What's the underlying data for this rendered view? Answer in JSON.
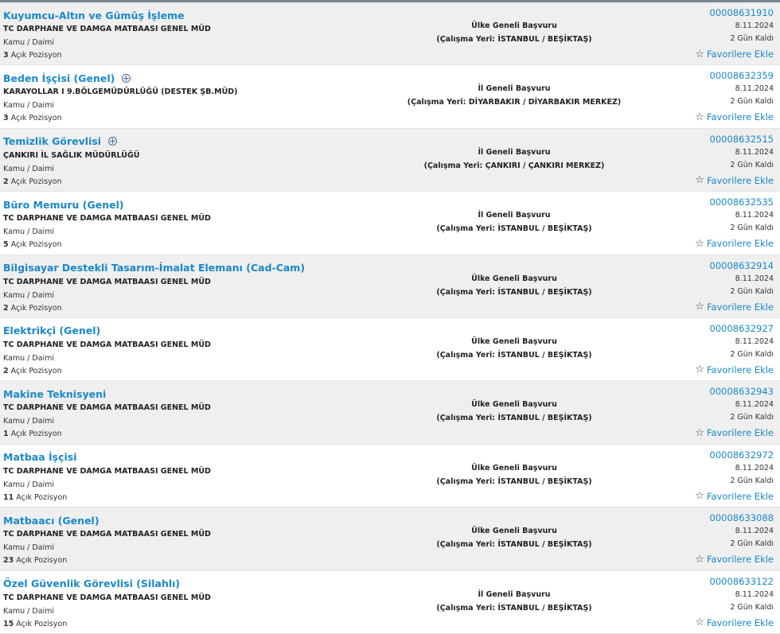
{
  "jobs": [
    {
      "title": "Kuyumcu-Altın ve Gümüş İşleme",
      "disabled": false,
      "org": "TC DARPHANE VE DAMGA MATBAASI GENEL MÜD",
      "type": "Kamu / Daimi",
      "positions_count": "3",
      "positions_label": "Açık Pozisyon",
      "scope": "Ülke Geneli Başvuru",
      "location": "(Çalışma Yeri: İSTANBUL / BEŞİKTAŞ)",
      "job_no": "00008631910",
      "date": "8.11.2024",
      "days_left": "2 Gün Kaldı",
      "fav_label": "Favorilere Ekle"
    },
    {
      "title": "Beden İşçisi (Genel)",
      "disabled": true,
      "org": "KARAYOLLAR I 9.BÖLGEMÜDÜRLÜĞÜ (DESTEK ŞB.MÜD)",
      "type": "Kamu / Daimi",
      "positions_count": "3",
      "positions_label": "Açık Pozisyon",
      "scope": "İl Geneli Başvuru",
      "location": "(Çalışma Yeri: DİYARBAKIR / DİYARBAKIR MERKEZ)",
      "job_no": "00008632359",
      "date": "8.11.2024",
      "days_left": "2 Gün Kaldı",
      "fav_label": "Favorilere Ekle"
    },
    {
      "title": "Temizlik Görevlisi",
      "disabled": true,
      "org": "ÇANKIRI İL SAĞLIK MÜDÜRLÜĞÜ",
      "type": "Kamu / Daimi",
      "positions_count": "2",
      "positions_label": "Açık Pozisyon",
      "scope": "İl Geneli Başvuru",
      "location": "(Çalışma Yeri: ÇANKIRI / ÇANKIRI MERKEZ)",
      "job_no": "00008632515",
      "date": "8.11.2024",
      "days_left": "2 Gün Kaldı",
      "fav_label": "Favorilere Ekle"
    },
    {
      "title": "Büro Memuru (Genel)",
      "disabled": false,
      "org": "TC DARPHANE VE DAMGA MATBAASI GENEL MÜD",
      "type": "Kamu / Daimi",
      "positions_count": "5",
      "positions_label": "Açık Pozisyon",
      "scope": "İl Geneli Başvuru",
      "location": "(Çalışma Yeri: İSTANBUL / BEŞİKTAŞ)",
      "job_no": "00008632535",
      "date": "8.11.2024",
      "days_left": "2 Gün Kaldı",
      "fav_label": "Favorilere Ekle"
    },
    {
      "title": "Bilgisayar Destekli Tasarım-İmalat Elemanı (Cad-Cam)",
      "disabled": false,
      "org": "TC DARPHANE VE DAMGA MATBAASI GENEL MÜD",
      "type": "Kamu / Daimi",
      "positions_count": "2",
      "positions_label": "Açık Pozisyon",
      "scope": "Ülke Geneli Başvuru",
      "location": "(Çalışma Yeri: İSTANBUL / BEŞİKTAŞ)",
      "job_no": "00008632914",
      "date": "8.11.2024",
      "days_left": "2 Gün Kaldı",
      "fav_label": "Favorilere Ekle"
    },
    {
      "title": "Elektrikçi (Genel)",
      "disabled": false,
      "org": "TC DARPHANE VE DAMGA MATBAASI GENEL MÜD",
      "type": "Kamu / Daimi",
      "positions_count": "2",
      "positions_label": "Açık Pozisyon",
      "scope": "Ülke Geneli Başvuru",
      "location": "(Çalışma Yeri: İSTANBUL / BEŞİKTAŞ)",
      "job_no": "00008632927",
      "date": "8.11.2024",
      "days_left": "2 Gün Kaldı",
      "fav_label": "Favorilere Ekle"
    },
    {
      "title": "Makine Teknisyeni",
      "disabled": false,
      "org": "TC DARPHANE VE DAMGA MATBAASI GENEL MÜD",
      "type": "Kamu / Daimi",
      "positions_count": "1",
      "positions_label": "Açık Pozisyon",
      "scope": "Ülke Geneli Başvuru",
      "location": "(Çalışma Yeri: İSTANBUL / BEŞİKTAŞ)",
      "job_no": "00008632943",
      "date": "8.11.2024",
      "days_left": "2 Gün Kaldı",
      "fav_label": "Favorilere Ekle"
    },
    {
      "title": "Matbaa İşçisi",
      "disabled": false,
      "org": "TC DARPHANE VE DAMGA MATBAASI GENEL MÜD",
      "type": "Kamu / Daimi",
      "positions_count": "11",
      "positions_label": "Açık Pozisyon",
      "scope": "Ülke Geneli Başvuru",
      "location": "(Çalışma Yeri: İSTANBUL / BEŞİKTAŞ)",
      "job_no": "00008632972",
      "date": "8.11.2024",
      "days_left": "2 Gün Kaldı",
      "fav_label": "Favorilere Ekle"
    },
    {
      "title": "Matbaacı (Genel)",
      "disabled": false,
      "org": "TC DARPHANE VE DAMGA MATBAASI GENEL MÜD",
      "type": "Kamu / Daimi",
      "positions_count": "23",
      "positions_label": "Açık Pozisyon",
      "scope": "Ülke Geneli Başvuru",
      "location": "(Çalışma Yeri: İSTANBUL / BEŞİKTAŞ)",
      "job_no": "00008633088",
      "date": "8.11.2024",
      "days_left": "2 Gün Kaldı",
      "fav_label": "Favorilere Ekle"
    },
    {
      "title": "Özel Güvenlik Görevlisi (Silahlı)",
      "disabled": false,
      "org": "TC DARPHANE VE DAMGA MATBAASI GENEL MÜD",
      "type": "Kamu / Daimi",
      "positions_count": "15",
      "positions_label": "Açık Pozisyon",
      "scope": "İl Geneli Başvuru",
      "location": "(Çalışma Yeri: İSTANBUL / BEŞİKTAŞ)",
      "job_no": "00008633122",
      "date": "8.11.2024",
      "days_left": "2 Gün Kaldı",
      "fav_label": "Favorilere Ekle"
    }
  ]
}
